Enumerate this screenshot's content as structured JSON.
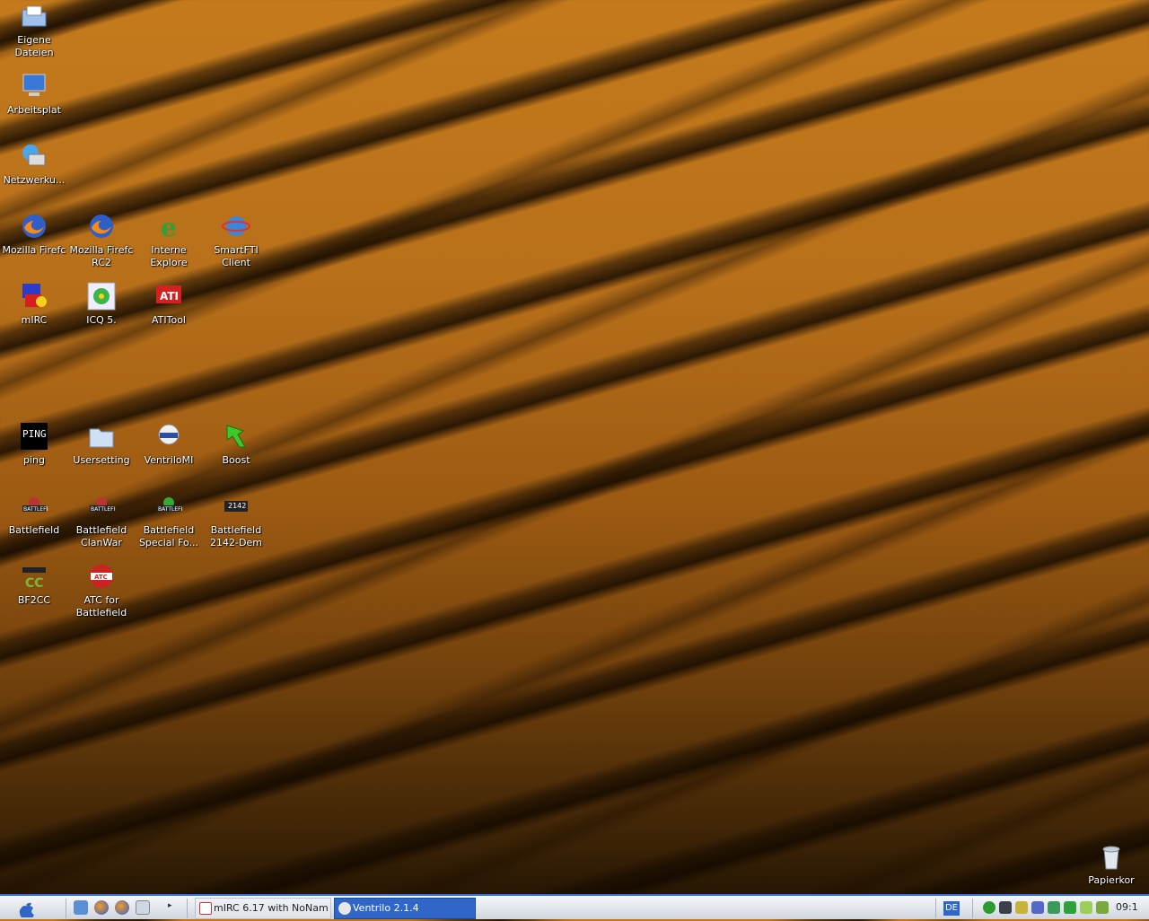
{
  "desktop": {
    "icons": [
      {
        "label": "Eigene Dateien",
        "icon": "folder-documents-icon"
      },
      {
        "label": "Arbeitsplat",
        "icon": "computer-icon"
      },
      {
        "label": "Netzwerku...",
        "icon": "network-icon"
      },
      {
        "label": "Mozilla Firefc",
        "icon": "firefox-icon"
      },
      {
        "label": "Mozilla Firefc\nRC2",
        "icon": "firefox-icon"
      },
      {
        "label": "Interne\nExplore",
        "icon": "internet-explorer-icon"
      },
      {
        "label": "SmartFTI\nClient",
        "icon": "smartftp-icon"
      },
      {
        "label": "mIRC",
        "icon": "mirc-icon"
      },
      {
        "label": "ICQ 5.",
        "icon": "icq-icon"
      },
      {
        "label": "ATITool",
        "icon": "atitool-icon"
      },
      {
        "label": "ping",
        "icon": "ping-icon"
      },
      {
        "label": "Usersetting",
        "icon": "folder-icon"
      },
      {
        "label": "VentriloMI",
        "icon": "ventrilo-icon"
      },
      {
        "label": "Boost",
        "icon": "boost-icon"
      },
      {
        "label": "Battlefield",
        "icon": "battlefield-icon"
      },
      {
        "label": "Battlefield\nClanWar",
        "icon": "battlefield-icon"
      },
      {
        "label": "Battlefield\nSpecial Fo...",
        "icon": "battlefield-icon"
      },
      {
        "label": "Battlefield\n2142-Dem",
        "icon": "battlefield-2142-icon"
      },
      {
        "label": "BF2CC",
        "icon": "bf2cc-icon"
      },
      {
        "label": "ATC for\nBattlefield",
        "icon": "atc-icon"
      },
      {
        "label": "Papierkor",
        "icon": "recycle-bin-icon"
      }
    ]
  },
  "taskbar": {
    "tasks": [
      {
        "label": "mIRC 6.17 with NoNam",
        "state": "inactive"
      },
      {
        "label": "Ventrilo 2.1.4",
        "state": "active"
      }
    ],
    "language": "DE",
    "clock": "09:1"
  },
  "colors": {
    "accent": "#2f66c8",
    "taskbar": "#e2e6ec"
  }
}
